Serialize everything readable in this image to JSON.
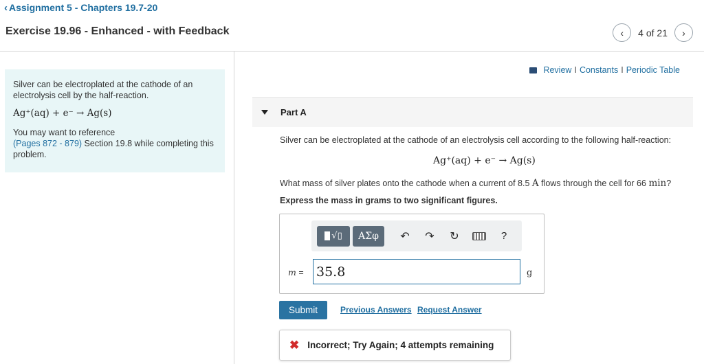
{
  "breadcrumb": {
    "chevron": "‹",
    "label": "Assignment 5 - Chapters 19.7-20"
  },
  "header": {
    "title": "Exercise 19.96 - Enhanced - with Feedback",
    "pager": {
      "prev": "‹",
      "count": "4 of 21",
      "next": "›"
    }
  },
  "info": {
    "text1": "Silver can be electroplated at the cathode of an electrolysis cell by the half-reaction.",
    "equation": "Ag⁺(aq) + e⁻ → Ag(s)",
    "ref_prefix": "You may want to reference",
    "ref_link": "(Pages 872 - 879)",
    "ref_suffix": " Section 19.8 while completing this problem."
  },
  "resources": {
    "review": "Review",
    "constants": "Constants",
    "periodic": "Periodic Table",
    "separator": "I"
  },
  "part": {
    "label": "Part A",
    "question_intro": "Silver can be electroplated at the cathode of an electrolysis cell according to the following half-reaction:",
    "equation": "Ag⁺(aq) + e⁻ → Ag(s)",
    "question_a": "What mass of silver plates onto the cathode when a current of 8.5 ",
    "current_unit": "A",
    "question_b": " flows through the cell for 66 ",
    "time_unit": "min",
    "question_c": "?",
    "instruction": "Express the mass in grams to two significant figures."
  },
  "toolbar": {
    "templates": "√▯",
    "greek": "ΑΣφ",
    "undo": "↶",
    "redo": "↷",
    "reset": "↻",
    "keyboard": "keyboard",
    "help": "?"
  },
  "answer": {
    "variable": "m",
    "equals": " =",
    "value": "35.8",
    "unit": "g"
  },
  "actions": {
    "submit": "Submit",
    "previous": "Previous Answers",
    "request": "Request Answer"
  },
  "feedback": {
    "icon": "✖",
    "message": "Incorrect; Try Again; 4 attempts remaining"
  },
  "colors": {
    "link": "#1f6ea0",
    "submit_bg": "#2a73a2",
    "info_bg": "#e8f6f7",
    "error": "#d22c2c",
    "toolbar_btn": "#5b6b79"
  }
}
